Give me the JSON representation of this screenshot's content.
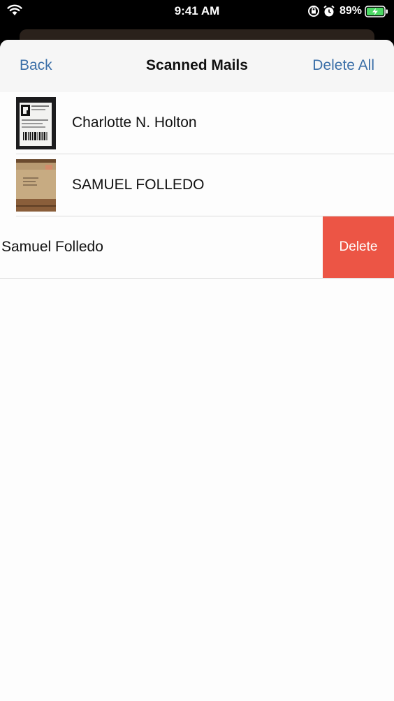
{
  "status_bar": {
    "time": "9:41 AM",
    "battery_percent": "89%",
    "icons": [
      "wifi-icon",
      "orientation-lock-icon",
      "alarm-icon",
      "battery-charging-icon"
    ]
  },
  "nav": {
    "back_label": "Back",
    "title": "Scanned Mails",
    "delete_all_label": "Delete All"
  },
  "mails": [
    {
      "name": "Charlotte N. Holton",
      "thumbnail": "shipping-label-photo"
    },
    {
      "name": "SAMUEL FOLLEDO",
      "thumbnail": "envelope-photo"
    },
    {
      "name": "Samuel Folledo",
      "swiped": true,
      "delete_label": "Delete"
    }
  ],
  "colors": {
    "accent": "#3b6fa8",
    "delete": "#ec5545",
    "battery": "#4cd964"
  }
}
